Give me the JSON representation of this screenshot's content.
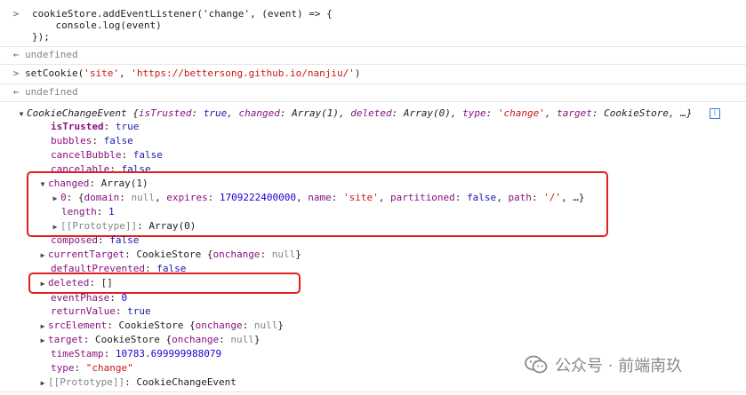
{
  "console": {
    "input1": {
      "prompt": ">",
      "line1": "cookieStore.addEventListener('change', (event) => {",
      "line2": "    console.log(event)",
      "line3": "});"
    },
    "result1": {
      "glyph": "←",
      "text": "undefined"
    },
    "input2": {
      "prompt": ">",
      "fn": "setCookie(",
      "arg1": "'site'",
      "comma": ", ",
      "arg2": "'https://bettersong.github.io/nanjiu/'",
      "close": ")"
    },
    "result2": {
      "glyph": "←",
      "text": "undefined"
    },
    "event": {
      "title": "CookieChangeEvent",
      "preview_open": " {",
      "p_isTrusted_k": "isTrusted",
      "p_isTrusted_v": "true",
      "p_changed_k": "changed",
      "p_changed_v": "Array(1)",
      "p_deleted_k": "deleted",
      "p_deleted_v": "Array(0)",
      "p_type_k": "type",
      "p_type_v": "'change'",
      "p_target_k": "target",
      "p_target_v": "CookieStore",
      "preview_close": ", …}",
      "info_icon": "i",
      "props": {
        "isTrusted": {
          "key": "isTrusted",
          "value": "true"
        },
        "bubbles": {
          "key": "bubbles",
          "value": "false"
        },
        "cancelBubble": {
          "key": "cancelBubble",
          "value": "false"
        },
        "cancelable": {
          "key": "cancelable",
          "value": "false"
        },
        "changed": {
          "key": "changed",
          "value": "Array(1)",
          "item0": {
            "index": "0",
            "domain_k": "domain",
            "domain_v": "null",
            "expires_k": "expires",
            "expires_v": "1709222400000",
            "name_k": "name",
            "name_v": "'site'",
            "partitioned_k": "partitioned",
            "partitioned_v": "false",
            "path_k": "path",
            "path_v": "'/'",
            "tail": ", …}"
          },
          "length_k": "length",
          "length_v": "1",
          "proto_k": "[[Prototype]]",
          "proto_v": "Array(0)"
        },
        "composed": {
          "key": "composed",
          "value": "false"
        },
        "currentTarget": {
          "key": "currentTarget",
          "value": "CookieStore",
          "preview_k": "onchange",
          "preview_v": "null"
        },
        "defaultPrevented": {
          "key": "defaultPrevented",
          "value": "false"
        },
        "deleted": {
          "key": "deleted",
          "value": "[]"
        },
        "eventPhase": {
          "key": "eventPhase",
          "value": "0"
        },
        "returnValue": {
          "key": "returnValue",
          "value": "true"
        },
        "srcElement": {
          "key": "srcElement",
          "value": "CookieStore",
          "preview_k": "onchange",
          "preview_v": "null"
        },
        "target": {
          "key": "target",
          "value": "CookieStore",
          "preview_k": "onchange",
          "preview_v": "null"
        },
        "timeStamp": {
          "key": "timeStamp",
          "value": "10783.699999988079"
        },
        "type": {
          "key": "type",
          "value": "\"change\""
        },
        "prototype": {
          "key": "[[Prototype]]",
          "value": "CookieChangeEvent"
        }
      }
    }
  },
  "watermark": {
    "text": "公众号 · 前端南玖",
    "icon": "wechat-icon"
  },
  "colors": {
    "highlight": "#e02020",
    "key": "#881280",
    "string": "#c41a16",
    "number": "#1c00cf",
    "null": "#80868b"
  }
}
